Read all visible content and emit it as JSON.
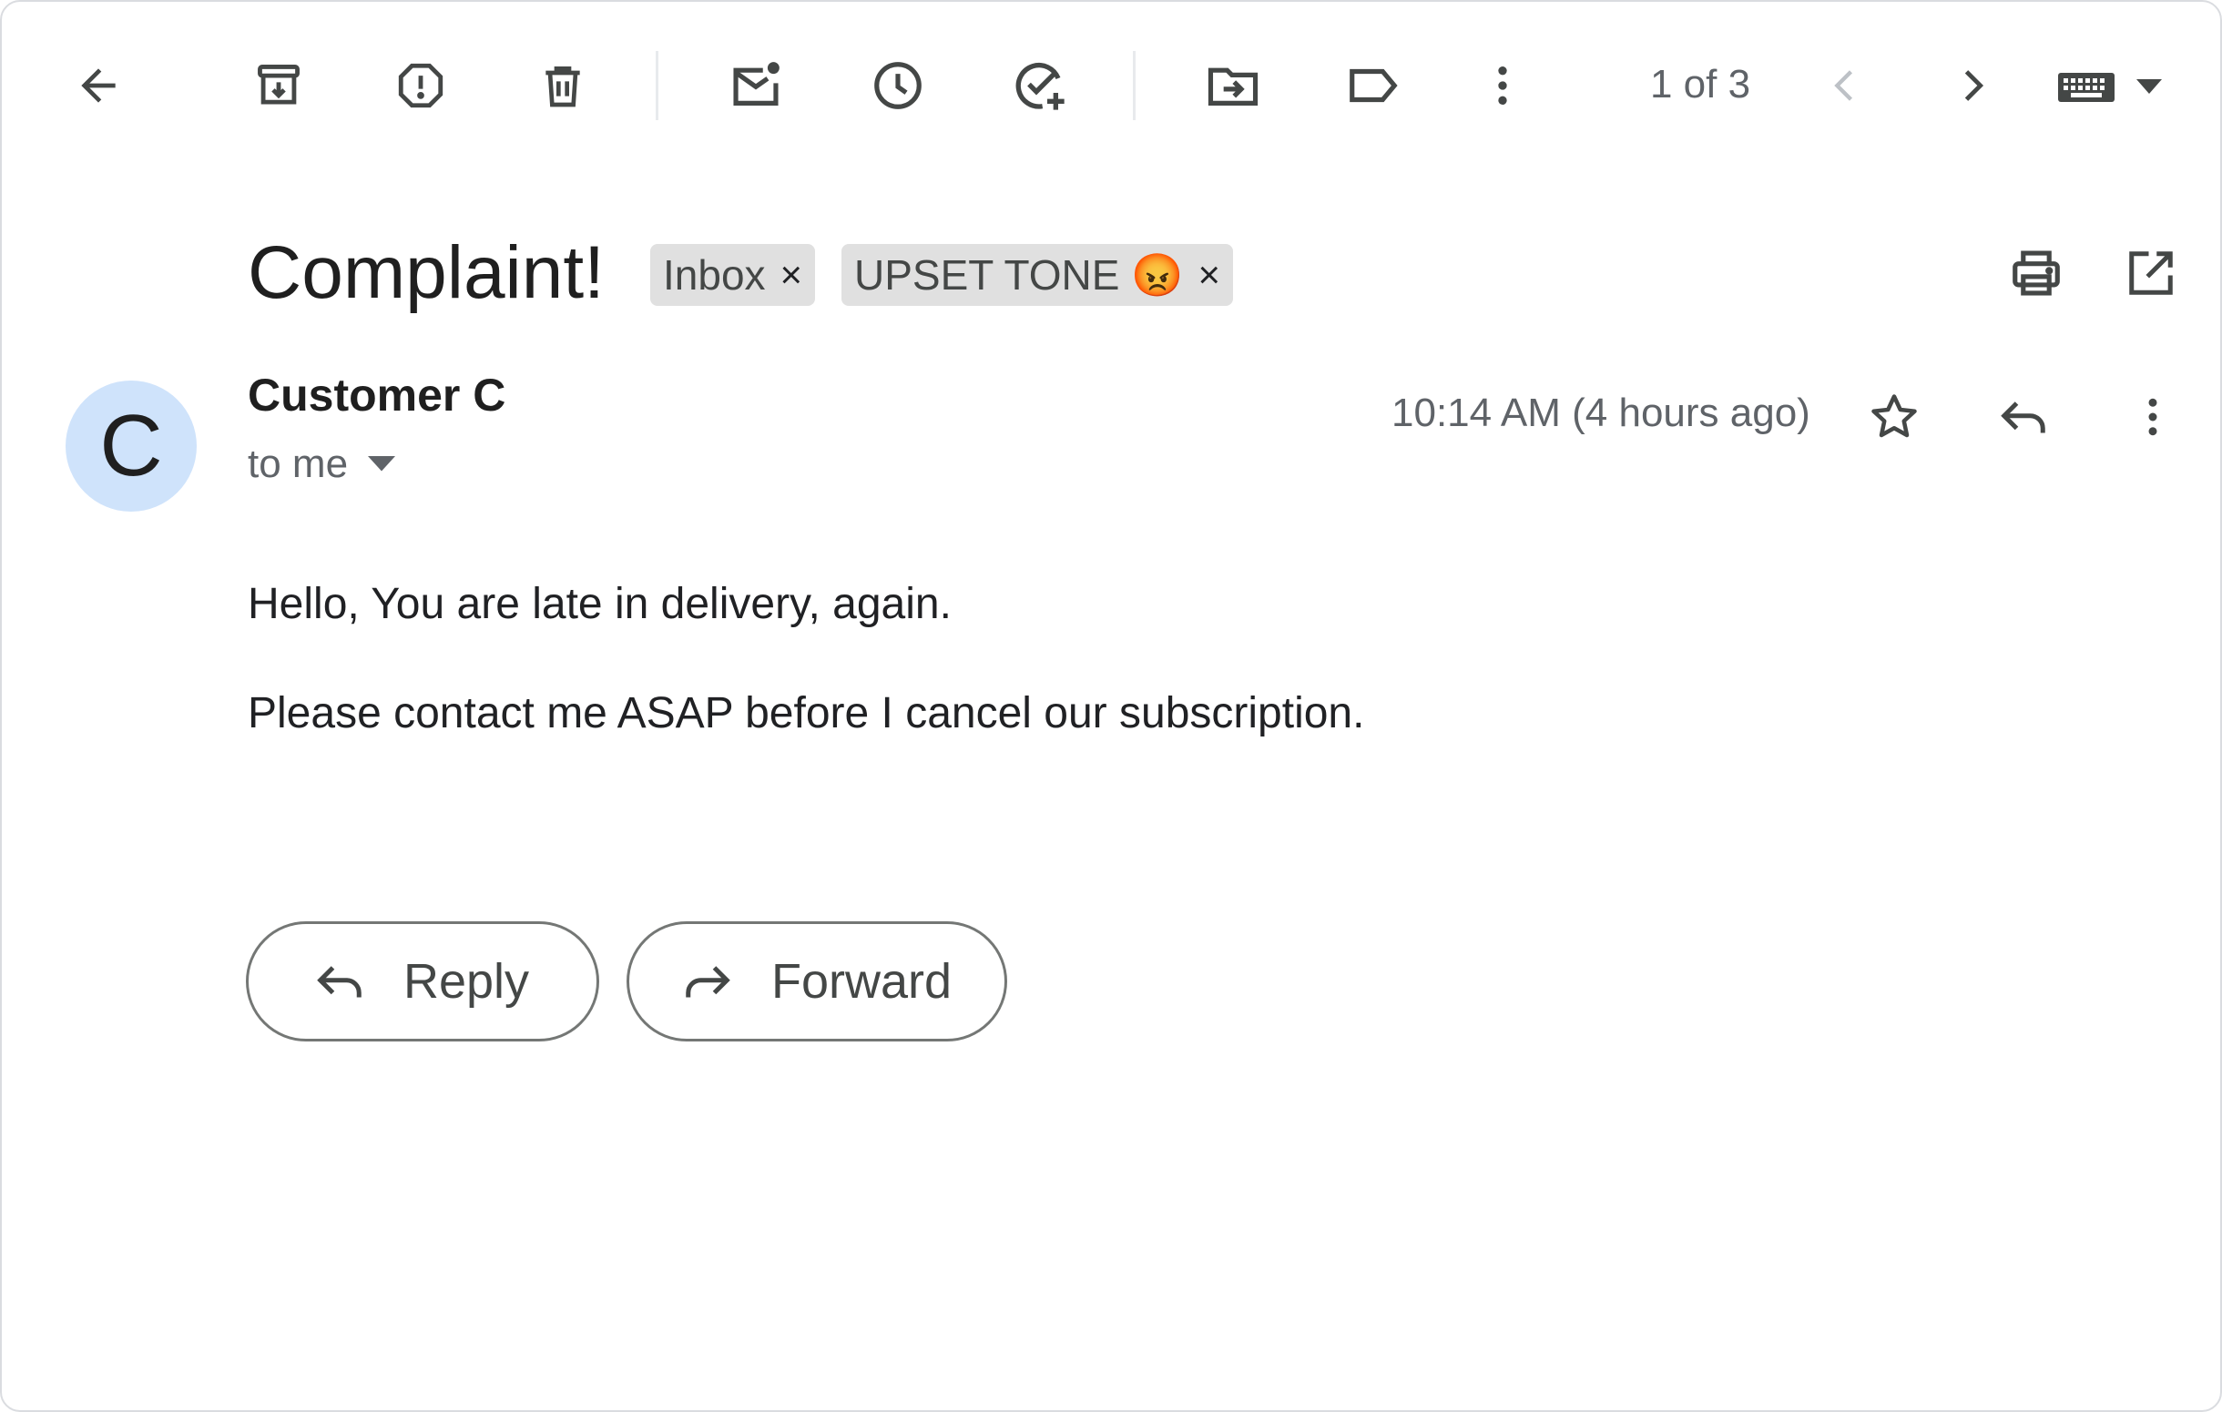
{
  "toolbar": {
    "icons": [
      "back-arrow-icon",
      "archive-icon",
      "report-spam-icon",
      "delete-icon",
      "mark-unread-icon",
      "snooze-icon",
      "add-to-tasks-icon",
      "move-to-icon",
      "label-icon",
      "more-vert-icon"
    ],
    "pager_text": "1 of 3",
    "prev_icon": "chevron-left-icon",
    "next_icon": "chevron-right-icon",
    "keyboard_icon": "keyboard-icon"
  },
  "message": {
    "subject": "Complaint!",
    "labels": [
      {
        "text": "Inbox",
        "remove": "×"
      },
      {
        "text": "UPSET TONE 😡",
        "remove": "×"
      }
    ],
    "header_icons": [
      "print-icon",
      "open-in-new-window-icon"
    ],
    "sender": {
      "avatar_letter": "C",
      "name": "Customer C",
      "recipient": "to me",
      "avatar_color": "#cfe3fb"
    },
    "time": "10:14 AM (4 hours ago)",
    "body": [
      "Hello, You are late in delivery, again.",
      "Please contact me ASAP before I cancel our subscription."
    ],
    "actions": {
      "reply": "Reply",
      "forward": "Forward"
    }
  },
  "colors": {
    "icon": "#444746",
    "secondary_text": "#5f6368",
    "chip_bg": "#e0e0e0",
    "button_border": "#747775"
  }
}
